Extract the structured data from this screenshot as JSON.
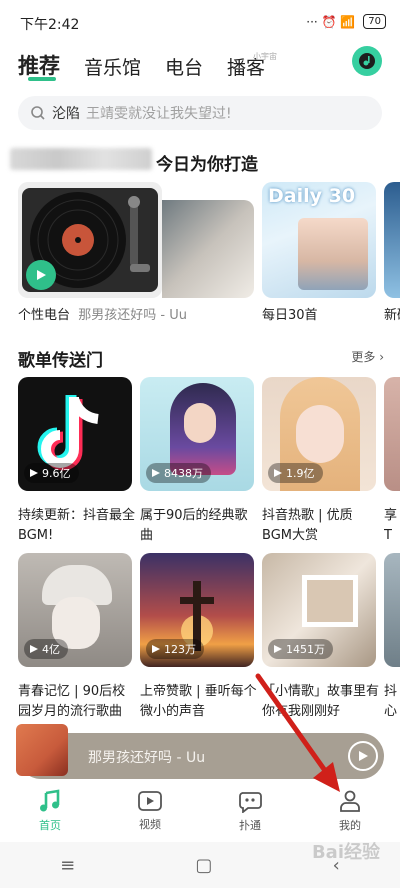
{
  "status_bar": {
    "time": "下午2:42",
    "icons_text": "··· ⏰ 📶 ",
    "battery": "70"
  },
  "header": {
    "tabs": [
      {
        "label": "推荐",
        "active": true
      },
      {
        "label": "音乐馆",
        "active": false
      },
      {
        "label": "电台",
        "active": false
      },
      {
        "label": "播客",
        "active": false
      }
    ],
    "tab_sub": "小宇宙",
    "accent": "#2fc08a"
  },
  "search": {
    "keyword": "沦陷",
    "hint": "王靖雯就没让我失望过!"
  },
  "today": {
    "title": "今日为你打造",
    "cards": [
      {
        "label": "个性电台",
        "sub": "那男孩还好吗 - Uu"
      },
      {
        "label": "每日30首",
        "cover_text": "Daily 30"
      },
      {
        "label": "新碟"
      }
    ]
  },
  "playlists": {
    "title": "歌单传送门",
    "more": "更多",
    "items": [
      {
        "count": "9.6亿",
        "title": "持续更新：抖音最全BGM!"
      },
      {
        "count": "8438万",
        "title": "属于90后的经典歌曲"
      },
      {
        "count": "1.9亿",
        "title": "抖音热歌 | 优质BGM大赏"
      },
      {
        "count": "",
        "title": "享T"
      },
      {
        "count": "4亿",
        "title": "青春记忆 | 90后校园岁月的流行歌曲"
      },
      {
        "count": "123万",
        "title": "上帝赞歌 | 垂听每个微小的声音"
      },
      {
        "count": "1451万",
        "title": "「小情歌」故事里有你有我刚刚好"
      },
      {
        "count": "",
        "title": "抖心"
      }
    ]
  },
  "player": {
    "title": "那男孩还好吗 - Uu"
  },
  "nav": {
    "items": [
      {
        "label": "首页",
        "active": true
      },
      {
        "label": "视频",
        "active": false
      },
      {
        "label": "扑通",
        "active": false
      },
      {
        "label": "我的",
        "active": false
      }
    ]
  },
  "system_nav": {
    "menu": "≡",
    "home": "▢",
    "back": "‹"
  },
  "watermark": "Bai经验"
}
